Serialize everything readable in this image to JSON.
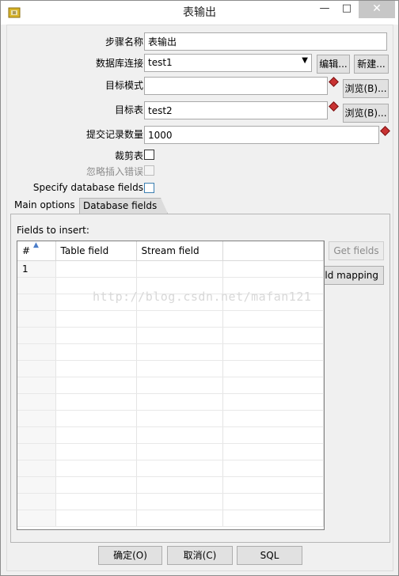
{
  "window": {
    "title": "表输出"
  },
  "form": {
    "step_name_label": "步骤名称",
    "step_name_value": "表输出",
    "db_conn_label": "数据库连接",
    "db_conn_value": "test1",
    "edit_button": "编辑...",
    "new_button": "新建...",
    "target_schema_label": "目标模式",
    "target_schema_value": "",
    "browse_schema_button": "浏览(B)...",
    "target_table_label": "目标表",
    "target_table_value": "test2",
    "browse_table_button": "浏览(B)...",
    "commit_size_label": "提交记录数量",
    "commit_size_value": "1000",
    "truncate_label": "裁剪表",
    "ignore_errors_label": "忽略插入错误",
    "specify_fields_label": "Specify database fields"
  },
  "tabs": [
    {
      "label": "Main options",
      "active": false
    },
    {
      "label": "Database fields",
      "active": true
    }
  ],
  "fields_panel": {
    "fields_label": "Fields to insert:",
    "get_fields_button": "Get fields",
    "mapping_button": "eld mapping",
    "columns": [
      "#",
      "Table field",
      "Stream field",
      ""
    ],
    "rows": [
      [
        "1",
        "",
        "",
        ""
      ]
    ]
  },
  "watermark": "http://blog.csdn.net/mafan121",
  "footer": {
    "ok_button": "确定(O)",
    "cancel_button": "取消(C)",
    "sql_button": "SQL"
  },
  "colors": {
    "required_marker": "#c83232",
    "close_button": "#c7c7c7"
  }
}
